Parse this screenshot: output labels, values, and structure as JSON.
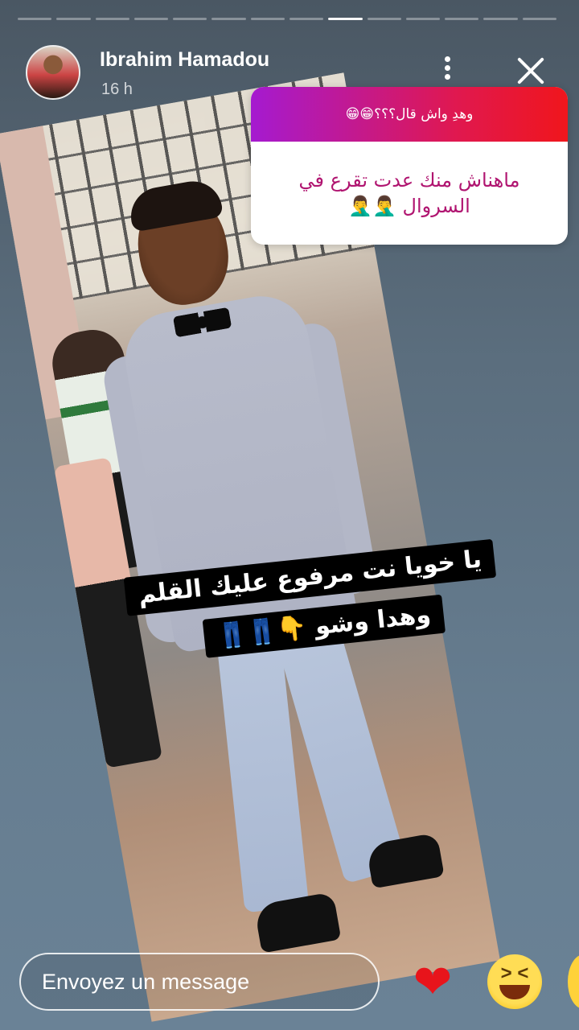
{
  "story": {
    "segments_total": 14,
    "segment_active_index": 8,
    "username": "Ibrahim Hamadou",
    "timestamp": "16 h"
  },
  "question_sticker": {
    "question": "وهدِ واش قال؟؟؟😁😁",
    "answer": "ماهناش منك عدت تقرع في السروال 🤦‍♂️🤦‍♂️"
  },
  "caption": {
    "line1": "يا خويا نت مرفوع عليك القلم",
    "line2": "وهدا وشو 👇👖👖"
  },
  "message_bar": {
    "placeholder": "Envoyez un message"
  },
  "reactions": [
    {
      "name": "heart-icon",
      "glyph": "❤"
    },
    {
      "name": "laughing-face-icon",
      "glyph": ""
    },
    {
      "name": "smiling-face-icon",
      "glyph": ""
    }
  ],
  "colors": {
    "question_gradient_start": "#a51ad0",
    "question_gradient_end": "#f0161c",
    "answer_text": "#b01470",
    "heart": "#e8141b"
  }
}
